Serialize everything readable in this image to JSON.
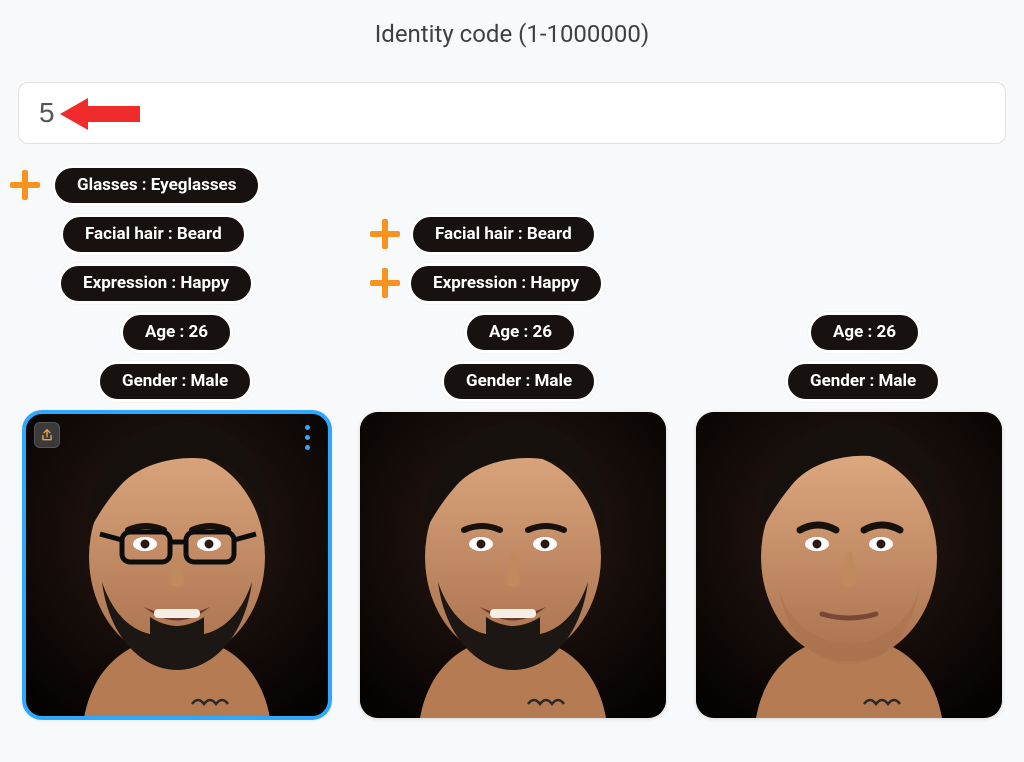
{
  "header": {
    "label": "Identity code (1-1000000)"
  },
  "input": {
    "value": "5"
  },
  "columns": [
    {
      "pills": [
        {
          "key": "glasses",
          "label": "Glasses : Eyeglasses",
          "plus": true
        },
        {
          "key": "facial_hair",
          "label": "Facial hair : Beard",
          "plus": false
        },
        {
          "key": "expression",
          "label": "Expression : Happy",
          "plus": false
        },
        {
          "key": "age",
          "label": "Age : 26",
          "plus": false
        },
        {
          "key": "gender",
          "label": "Gender : Male",
          "plus": false
        }
      ],
      "selected": true
    },
    {
      "pills": [
        {
          "key": "facial_hair",
          "label": "Facial hair : Beard",
          "plus": true
        },
        {
          "key": "expression",
          "label": "Expression : Happy",
          "plus": true
        },
        {
          "key": "age",
          "label": "Age : 26",
          "plus": false
        },
        {
          "key": "gender",
          "label": "Gender : Male",
          "plus": false
        }
      ],
      "selected": false
    },
    {
      "pills": [
        {
          "key": "age",
          "label": "Age : 26",
          "plus": false
        },
        {
          "key": "gender",
          "label": "Gender : Male",
          "plus": false
        }
      ],
      "selected": false
    }
  ]
}
